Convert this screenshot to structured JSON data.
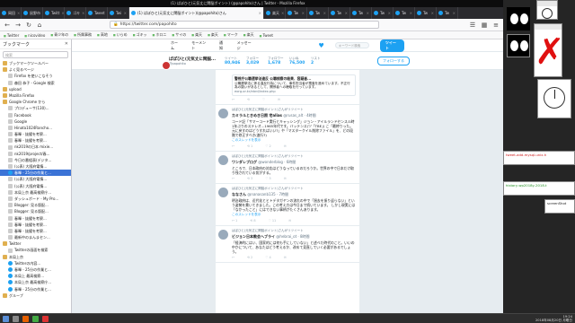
{
  "window": {
    "title": "(1) ぱぽひと(元気丈に閑脳ポイント) (@papohito)さん | Twitter - Mozilla Firefox"
  },
  "tabs": [
    {
      "label": "岡田 "
    },
    {
      "label": "鼠野市 "
    },
    {
      "label": "Twitt "
    },
    {
      "label": "ゴキ "
    },
    {
      "label": "Tweet "
    },
    {
      "label": "Twi "
    },
    {
      "label": "(1) ぱぽひと(元気丈に閑脳ポイント)(@papohito)さん",
      "active": true
    },
    {
      "label": "楽天 "
    },
    {
      "label": "Tw "
    },
    {
      "label": "Tw "
    },
    {
      "label": "Tw "
    },
    {
      "label": "Tw "
    },
    {
      "label": "Tw "
    },
    {
      "label": "Tw "
    },
    {
      "label": "Tw "
    },
    {
      "label": "Tw "
    }
  ],
  "nav": {
    "url": "https://twitter.com/papohito"
  },
  "bookmarks_toolbar": [
    "Twitter",
    "nicovideo",
    "青少年の",
    "所属事務",
    "高地",
    "いらめ",
    "ゴキッ",
    "ホロニ",
    "サイの",
    "楽天",
    "楽天",
    "マーク",
    "楽天",
    "Tweet"
  ],
  "sidebar": {
    "title": "ブックマーク",
    "search_placeholder": "検索",
    "items": [
      {
        "label": "ブックマークツールバー",
        "type": "folder"
      },
      {
        "label": "よく見るページ",
        "type": "folder"
      },
      {
        "label": "Firefox を使いこなそう",
        "type": "page"
      },
      {
        "label": "森田 恭子 - Google 検索",
        "type": "page"
      },
      {
        "label": "upload",
        "type": "folder"
      },
      {
        "label": "Mozilla Firefox",
        "type": "folder"
      },
      {
        "label": "Google Chrome から",
        "type": "folder"
      },
      {
        "label": "プロデューサ(130)...",
        "type": "page"
      },
      {
        "label": "Facebook",
        "type": "page"
      },
      {
        "label": "Google",
        "type": "page"
      },
      {
        "label": "Hinata1024Rancho...",
        "type": "page"
      },
      {
        "label": "春暉 - 抜擢を考察...",
        "type": "page"
      },
      {
        "label": "春暉 - 抜擢を考察...",
        "type": "page"
      },
      {
        "label": "nk2019の日本 mixie...",
        "type": "page"
      },
      {
        "label": "nk2019/project/春...",
        "type": "page"
      },
      {
        "label": "今日の番組表(デジタ...",
        "type": "page"
      },
      {
        "label": "(公表) 大阪府電情...",
        "type": "page"
      },
      {
        "label": "春暉 - 25分の作業と...",
        "type": "tw",
        "selected": true
      },
      {
        "label": "(公表) 大阪府電情...",
        "type": "page"
      },
      {
        "label": "(公表) 大阪府電情...",
        "type": "page"
      },
      {
        "label": "本局上京 最高検察庁...",
        "type": "page"
      },
      {
        "label": "ダッシュボード - My Pro...",
        "type": "page"
      },
      {
        "label": "Blogger: 見る版配...",
        "type": "page"
      },
      {
        "label": "Blogger: 見る版配...",
        "type": "page"
      },
      {
        "label": "春暉 - 抜擢を考察...",
        "type": "page"
      },
      {
        "label": "春暉 - 抜擢を考察...",
        "type": "page"
      },
      {
        "label": "春暉 - 抜擢を考察...",
        "type": "page"
      },
      {
        "label": "最新中のまんまセン...",
        "type": "page"
      },
      {
        "label": "Twitter",
        "type": "folder"
      },
      {
        "label": "Twitterの画面を検索",
        "type": "page"
      },
      {
        "label": "本局上京",
        "type": "folder"
      },
      {
        "label": "Twitterの内容...",
        "type": "tw"
      },
      {
        "label": "春暉 - 25分の作業と...",
        "type": "tw"
      },
      {
        "label": "本局上 最高検察...",
        "type": "tw"
      },
      {
        "label": "本局上京 最高検察庁...",
        "type": "tw"
      },
      {
        "label": "春暉 - 25分の作業と...",
        "type": "tw"
      },
      {
        "label": "グループ",
        "type": "folder"
      }
    ]
  },
  "twitter_nav": {
    "home": "ホーム",
    "moments": "モーメント",
    "notifications": "通知",
    "messages": "メッセージ",
    "search_placeholder": "キーワード検索",
    "tweet_button": "ツイート"
  },
  "profile": {
    "name": "ぱぽひと(元気丈に閑脳...",
    "handle": "@papohito",
    "stats": [
      {
        "label": "ツイート",
        "value": "80,946"
      },
      {
        "label": "フォロー",
        "value": "3,029"
      },
      {
        "label": "フォロワー",
        "value": "1,678"
      },
      {
        "label": "いいね",
        "value": "76,500"
      },
      {
        "label": "リスト",
        "value": "2"
      }
    ],
    "follow_button": "フォローする"
  },
  "tweets": [
    {
      "context": "",
      "name": "",
      "handle": "",
      "text": "",
      "card_title": "警視庁公職選挙法違反 公職検察の結果、容疑者...",
      "card_text": "公職選挙法に係る違反行為について、事件担当者が捜査を進めています。不正行為の疑いがあるとして、関係者への聴取を行っています。",
      "card_domain": "eorg.or.kr/ebrd/index.php",
      "acts": [
        "↩",
        "⟲",
        "♡",
        "✉"
      ]
    },
    {
      "context": "ぱぽひと(元気丈に閑脳ポイント)さんがリツイート",
      "name": "カミラルときめき日照 宅alias",
      "handle": "@rusas_alt · 4時間",
      "text": "コード記「サマーコード実行とキャッシング」ジョン・アイルランドセンスル時1年ぶりのステレオ...1965年代です。バッテンス(ツ「TBE」) こ「最終りった。元に戻すのはどうすればいい?」や「マスタークイル削除ファイル」を、どの段階で修正すべき(進行?)",
      "more": "このスレッドを表示",
      "acts": [
        "↩",
        "⟲ 1",
        "♡ 2",
        "✉"
      ]
    },
    {
      "context": "ぱぽひと(元気丈に閑脳ポイント)さんがリツイート",
      "name": "ワンダレブログ",
      "handle": "@wonderblog · 6時間",
      "text": "ところで、日本政府の対応はどうなっているのだろうか。世界の中で日本だけ取り残されている気がする。",
      "acts": [
        "↩",
        "⟲ 3",
        "♡ 5",
        "✉"
      ]
    },
    {
      "context": "ぱぽひと(元気丈に閑脳ポイント)さんがリツイート",
      "name": "ななさん",
      "handle": "@nanasanb135 · 7時間",
      "text": "明治政府は、近代化とヒトデタガヤンの流れの中で「過去を振り返らない」という姿勢を貫いてきました。この考え方は今日まで続いています。 しかし現実には「なかったこと」にはできない事柄がたくさんあります。",
      "more": "このスレッドを表示",
      "acts": [
        "↩ 1",
        "⟲ 8",
        "♡ 11",
        "✉"
      ]
    },
    {
      "context": "ぱぽひと(元気丈に閑脳ポイント)さんがリツイート",
      "name": "ビジョン日本教会ヘブライ",
      "handle": "@hebrai_ot · 8時間",
      "text": "「経済的にはい、国家的には何も手にしていない」と述べた時代のこと。いいの中かについて、あなたはどう考えるか、改めて見直していく必要があるでしょう。",
      "acts": [
        "↩",
        "⟲ 2",
        "♡ 4",
        "✉"
      ]
    }
  ],
  "desktop": {
    "note1": "tweet-add-mysql-unix.h",
    "note2": "history-wp2018y-2018.t",
    "note3": "screenShot"
  },
  "taskbar": {
    "time": "19:24",
    "date": "2018年08月20日 月曜日"
  }
}
